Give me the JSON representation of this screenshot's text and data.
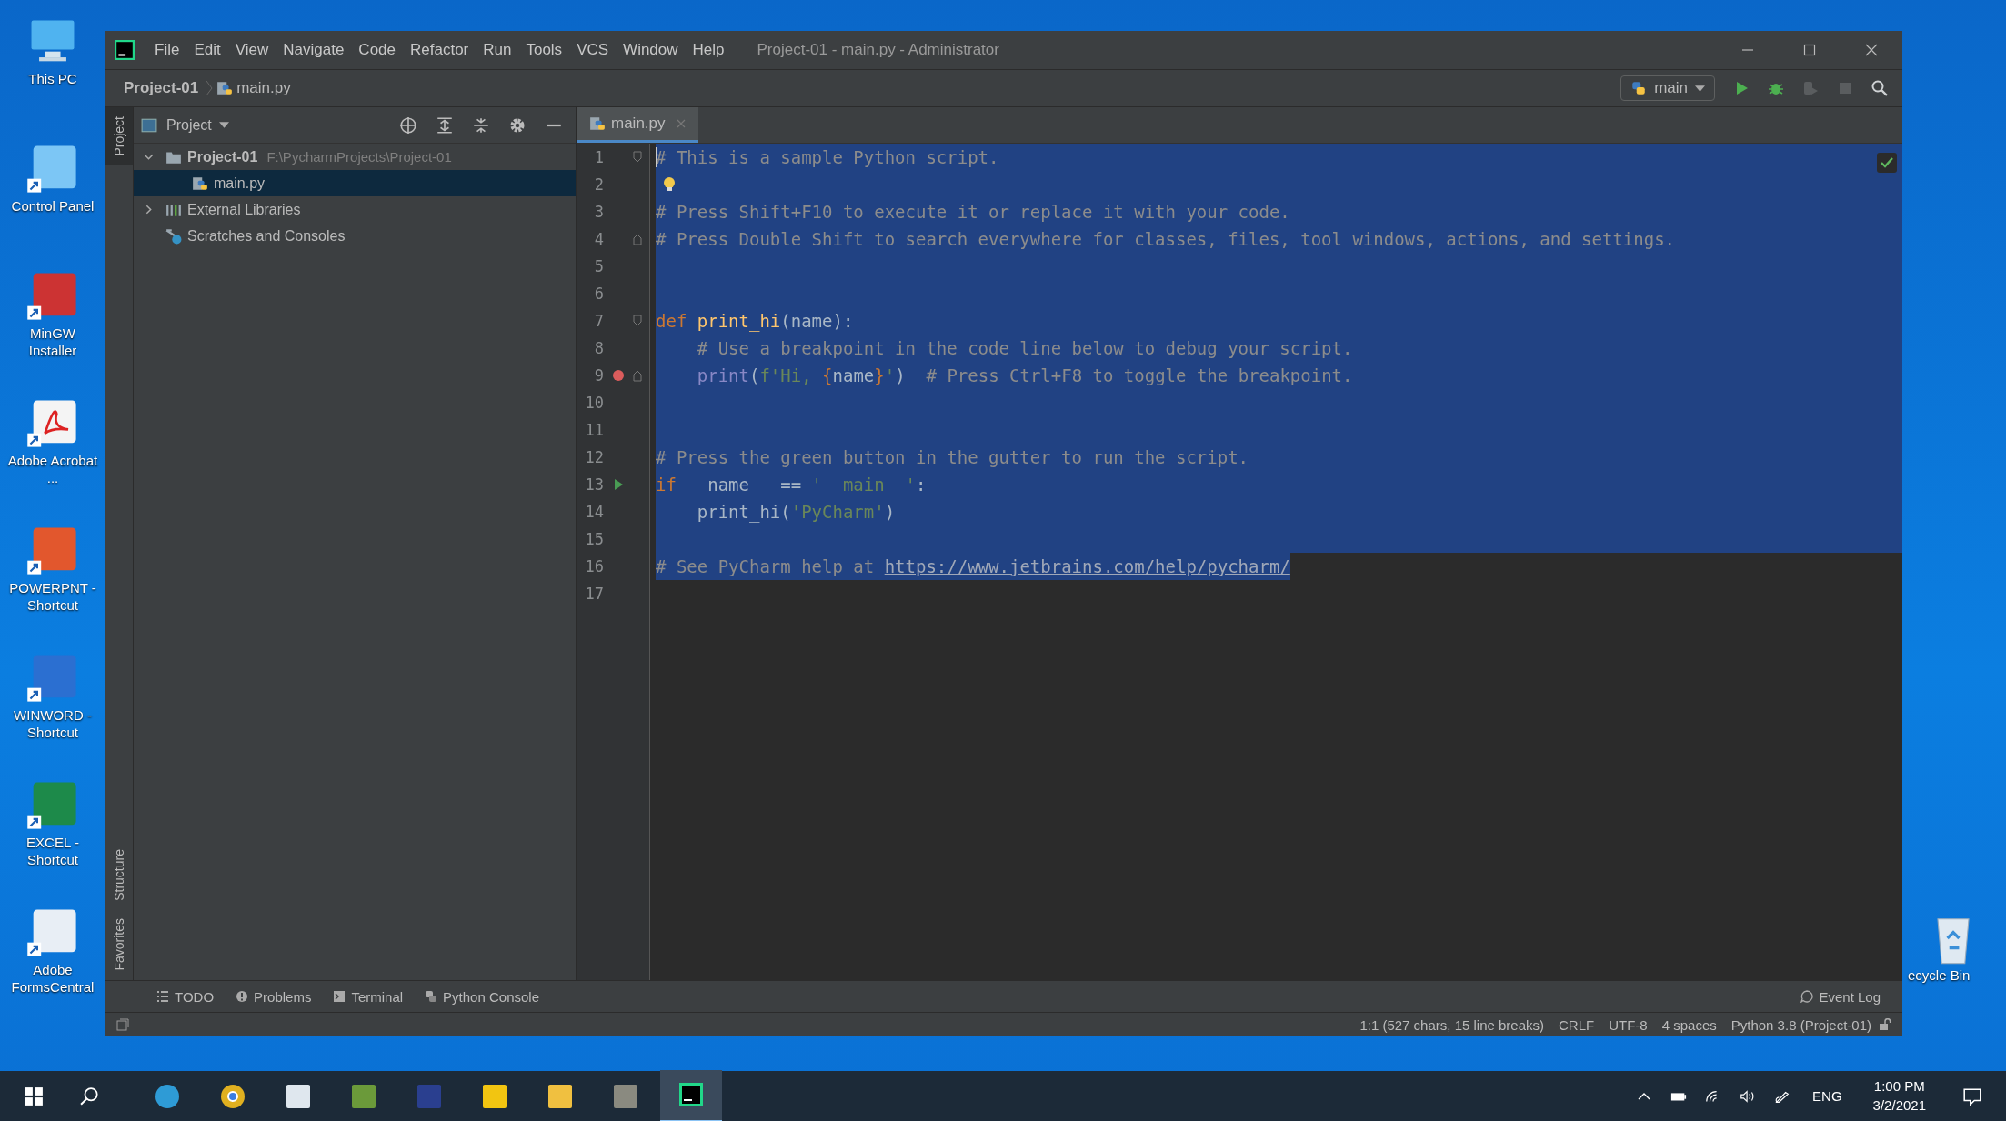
{
  "desktop": {
    "icons": [
      {
        "label": "This PC",
        "kind": "pc"
      },
      {
        "label": "Control Panel",
        "kind": "control"
      },
      {
        "label": "MinGW Installer",
        "kind": "installer"
      },
      {
        "label": "Adobe Acrobat ...",
        "kind": "pdf"
      },
      {
        "label": "POWERPNT - Shortcut",
        "kind": "slides"
      },
      {
        "label": "WINWORD - Shortcut",
        "kind": "doc"
      },
      {
        "label": "EXCEL - Shortcut",
        "kind": "sheet"
      },
      {
        "label": "Adobe FormsCentral",
        "kind": "form"
      }
    ],
    "recycle_bin": {
      "label": "ecycle Bin"
    }
  },
  "window": {
    "title": "Project-01 - main.py - Administrator",
    "menu": [
      "File",
      "Edit",
      "View",
      "Navigate",
      "Code",
      "Refactor",
      "Run",
      "Tools",
      "VCS",
      "Window",
      "Help"
    ],
    "breadcrumb": [
      "Project-01",
      "main.py"
    ],
    "run_config": "main",
    "toolbar": [
      {
        "kind": "run",
        "disabled": false
      },
      {
        "kind": "debug",
        "disabled": false
      },
      {
        "kind": "coverage",
        "disabled": true
      },
      {
        "kind": "stop",
        "disabled": true
      },
      {
        "kind": "search",
        "disabled": false
      }
    ]
  },
  "side_stripe_top": [
    {
      "label": "Project",
      "selected": true
    }
  ],
  "side_stripe_bottom": [
    {
      "label": "Structure",
      "selected": false
    },
    {
      "label": "Favorites",
      "selected": false
    }
  ],
  "project_panel": {
    "title": "Project",
    "tree": [
      {
        "label": "Project-01",
        "path": "F:\\PycharmProjects\\Project-01",
        "kind": "folder",
        "expanded": true,
        "selected": false,
        "children": [
          {
            "label": "main.py",
            "kind": "python",
            "selected": true
          }
        ]
      },
      {
        "label": "External Libraries",
        "kind": "library",
        "expanded": false,
        "selected": false
      },
      {
        "label": "Scratches and Consoles",
        "kind": "scratch",
        "selected": false
      }
    ]
  },
  "editor": {
    "tabs": [
      {
        "label": "main.py",
        "selected": true
      }
    ],
    "lines": [
      {
        "number": "1",
        "selected": true,
        "fold_start": true,
        "caret": true,
        "tokens": [
          {
            "kind": "comment",
            "text": "# This is a sample Python script."
          }
        ]
      },
      {
        "number": "2",
        "selected": true,
        "bulb": true
      },
      {
        "number": "3",
        "selected": true,
        "tokens": [
          {
            "kind": "comment",
            "text": "# Press Shift+F10 to execute it or replace it with your code."
          }
        ]
      },
      {
        "number": "4",
        "selected": true,
        "fold_end": true,
        "tokens": [
          {
            "kind": "comment",
            "text": "# Press Double Shift to search everywhere for classes, files, tool windows, actions, and settings."
          }
        ]
      },
      {
        "number": "5",
        "selected": true
      },
      {
        "number": "6",
        "selected": true
      },
      {
        "number": "7",
        "selected": true,
        "fold_start": true,
        "tokens": [
          {
            "kind": "keyword",
            "text": "def"
          },
          {
            "kind": "function",
            "text": " print_hi"
          },
          {
            "kind": "plain",
            "text": "(name):"
          }
        ]
      },
      {
        "number": "8",
        "selected": true,
        "tokens": [
          {
            "kind": "comment",
            "text": "    # Use a breakpoint in the code line below to debug your script."
          }
        ]
      },
      {
        "number": "9",
        "selected": true,
        "fold_end": true,
        "breakpoint": true,
        "tokens": [
          {
            "kind": "builtin",
            "text": "    print"
          },
          {
            "kind": "plain",
            "text": "("
          },
          {
            "kind": "string",
            "text": "f'Hi, "
          },
          {
            "kind": "brace",
            "text": "{"
          },
          {
            "kind": "plain",
            "text": "name"
          },
          {
            "kind": "brace",
            "text": "}"
          },
          {
            "kind": "string",
            "text": "'"
          },
          {
            "kind": "plain",
            "text": ")  "
          },
          {
            "kind": "comment",
            "text": "# Press Ctrl+F8 to toggle the breakpoint."
          }
        ]
      },
      {
        "number": "10",
        "selected": true
      },
      {
        "number": "11",
        "selected": true
      },
      {
        "number": "12",
        "selected": true,
        "tokens": [
          {
            "kind": "comment",
            "text": "# Press the green button in the gutter to run the script."
          }
        ]
      },
      {
        "number": "13",
        "selected": true,
        "run_marker": true,
        "tokens": [
          {
            "kind": "keyword",
            "text": "if"
          },
          {
            "kind": "plain",
            "text": " __name__ == "
          },
          {
            "kind": "string",
            "text": "'__main__'"
          },
          {
            "kind": "plain",
            "text": ":"
          }
        ]
      },
      {
        "number": "14",
        "selected": true,
        "tokens": [
          {
            "kind": "plain",
            "text": "    print_hi("
          },
          {
            "kind": "string",
            "text": "'PyCharm'"
          },
          {
            "kind": "plain",
            "text": ")"
          }
        ]
      },
      {
        "number": "15",
        "selected": true
      },
      {
        "number": "16",
        "selected": true,
        "tokens": [
          {
            "kind": "comment",
            "text": "# See PyCharm help at "
          },
          {
            "kind": "link",
            "text": "https://www.jetbrains.com/help/pycharm/"
          }
        ]
      },
      {
        "number": "17",
        "selected": false
      }
    ]
  },
  "tool_tabs": [
    {
      "label": "TODO",
      "kind": "todo"
    },
    {
      "label": "Problems",
      "kind": "problems"
    },
    {
      "label": "Terminal",
      "kind": "terminal"
    },
    {
      "label": "Python Console",
      "kind": "console"
    }
  ],
  "event_log": "Event Log",
  "status": [
    "1:1 (527 chars, 15 line breaks)",
    "CRLF",
    "UTF-8",
    "4 spaces",
    "Python 3.8 (Project-01)"
  ],
  "taskbar": {
    "apps": [
      {
        "kind": "edge",
        "selected": false
      },
      {
        "kind": "chrome",
        "selected": false
      },
      {
        "kind": "chart",
        "selected": false
      },
      {
        "kind": "editor",
        "selected": false
      },
      {
        "kind": "devcpp",
        "selected": false
      },
      {
        "kind": "notes",
        "selected": false
      },
      {
        "kind": "explorer",
        "selected": false
      },
      {
        "kind": "gimp",
        "selected": false
      },
      {
        "kind": "pycharm",
        "selected": true
      }
    ],
    "language": "ENG",
    "time": "1:00 PM",
    "date": "3/2/2021"
  }
}
